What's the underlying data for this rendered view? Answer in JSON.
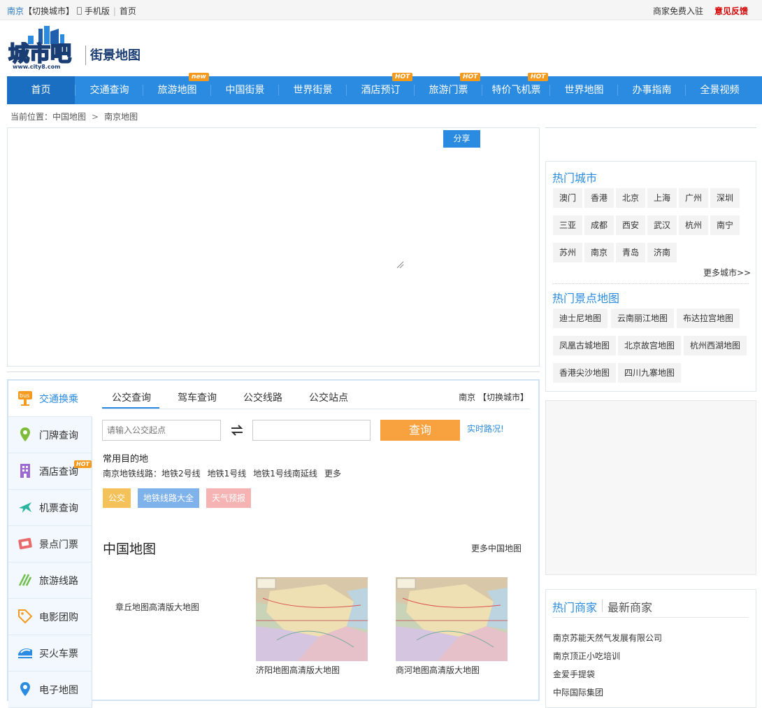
{
  "topbar": {
    "city": "南京",
    "switch_city": "【切换城市】",
    "mobile": "手机版",
    "home": "首页",
    "merchant": "商家免费入驻",
    "feedback": "意见反馈"
  },
  "header": {
    "logo_text": "城市吧",
    "logo_url": "www.city8.com",
    "subtitle": "街景地图"
  },
  "nav": {
    "items": [
      {
        "label": "首页"
      },
      {
        "label": "交通查询"
      },
      {
        "label": "旅游地图",
        "badge": "new"
      },
      {
        "label": "中国街景"
      },
      {
        "label": "世界街景"
      },
      {
        "label": "酒店预订",
        "badge": "HOT"
      },
      {
        "label": "旅游门票",
        "badge": "HOT"
      },
      {
        "label": "特价飞机票",
        "badge": "HOT"
      },
      {
        "label": "世界地图"
      },
      {
        "label": "办事指南"
      },
      {
        "label": "全景视频"
      }
    ]
  },
  "breadcrumb": {
    "prefix": "当前位置：",
    "items": [
      "中国地图",
      "南京地图"
    ],
    "separator": ">"
  },
  "map": {
    "share_label": "分享"
  },
  "side_menu": {
    "items": [
      {
        "label": "交通换乘",
        "icon": "bus-icon"
      },
      {
        "label": "门牌查询",
        "icon": "location-pin-icon"
      },
      {
        "label": "酒店查询",
        "icon": "hotel-icon",
        "badge": "HOT"
      },
      {
        "label": "机票查询",
        "icon": "airplane-icon"
      },
      {
        "label": "景点门票",
        "icon": "ticket-icon"
      },
      {
        "label": "旅游线路",
        "icon": "route-icon"
      },
      {
        "label": "电影团购",
        "icon": "tag-icon"
      },
      {
        "label": "买火车票",
        "icon": "train-icon"
      },
      {
        "label": "电子地图",
        "icon": "map-icon"
      }
    ]
  },
  "bus_tool": {
    "tabs": [
      "公交查询",
      "驾车查询",
      "公交线路",
      "公交站点"
    ],
    "city_label": "南京 【切换城市】",
    "start_placeholder": "请输入公交起点",
    "end_value": "",
    "query_button": "查询",
    "realtime": "实时路况!",
    "common_title": "常用目的地",
    "metro_prefix": "南京地铁线路：",
    "metro_lines": [
      "地铁2号线",
      "地铁1号线",
      "地铁1号线南延线",
      "更多"
    ],
    "tags": [
      {
        "label": "公交",
        "color": "#f4c15a"
      },
      {
        "label": "地铁线路大全",
        "color": "#7fb2ea"
      },
      {
        "label": "天气预报",
        "color": "#f5b3b3"
      }
    ]
  },
  "china_maps": {
    "title": "中国地图",
    "more": "更多中国地图",
    "items": [
      "章丘地图高清版大地图",
      "济阳地图高清版大地图",
      "商河地图高清版大地图"
    ]
  },
  "hot_cities": {
    "title": "热门城市",
    "cities": [
      "澳门",
      "香港",
      "北京",
      "上海",
      "广州",
      "深圳",
      "三亚",
      "成都",
      "西安",
      "武汉",
      "杭州",
      "南宁",
      "苏州",
      "南京",
      "青岛",
      "济南"
    ],
    "more": "更多城市>>"
  },
  "hot_spots": {
    "title": "热门景点地图",
    "items": [
      "迪士尼地图",
      "云南丽江地图",
      "布达拉宫地图",
      "凤凰古城地图",
      "北京故宫地图",
      "杭州西湖地图",
      "香港尖沙地图",
      "四川九寨地图"
    ]
  },
  "merchants": {
    "tab_hot": "热门商家",
    "tab_new": "最新商家",
    "items": [
      "南京苏能天然气发展有限公司",
      "南京顶正小吃培训",
      "金爱手提袋",
      "中际国际集团"
    ]
  },
  "colors": {
    "nav_blue": "#2a8be0",
    "nav_active": "#1a6fc2",
    "hot_orange": "#f39a1f",
    "query_orange": "#f7a13f",
    "feedback_red": "#d40000"
  }
}
